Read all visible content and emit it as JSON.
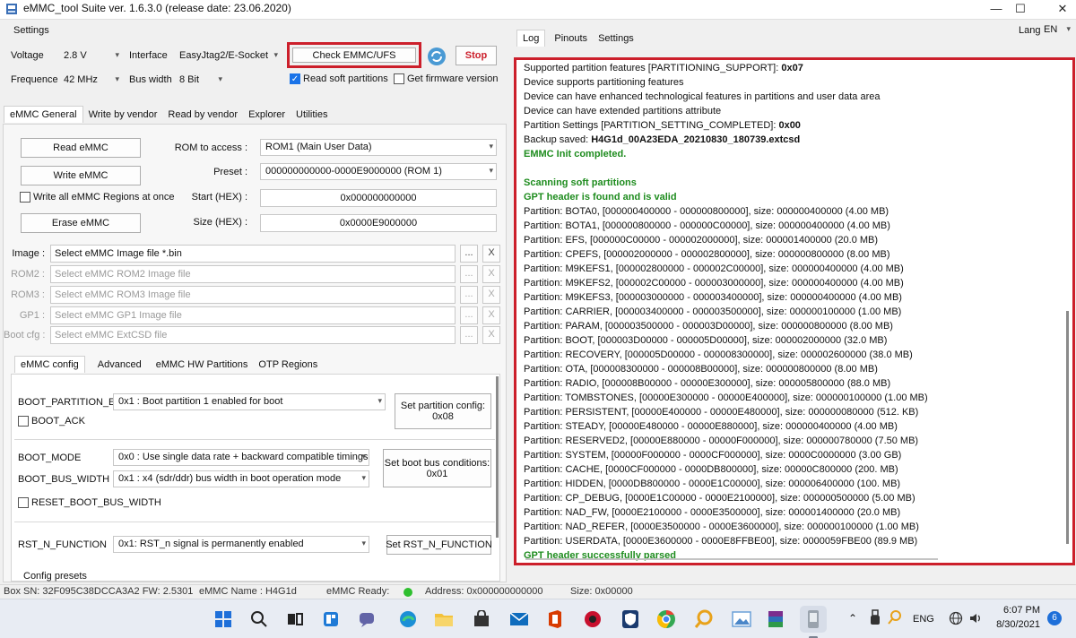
{
  "window": {
    "title": "eMMC_tool Suite  ver. 1.6.3.0 (release date: 23.06.2020)",
    "minimize": "—",
    "maximize": "☐",
    "close": "✕"
  },
  "settings": {
    "group_label": "Settings",
    "voltage_label": "Voltage",
    "voltage_value": "2.8 V",
    "interface_label": "Interface",
    "interface_value": "EasyJtag2/E-Socket",
    "frequency_label": "Frequence",
    "frequency_value": "42 MHz",
    "buswidth_label": "Bus width",
    "buswidth_value": "8 Bit",
    "check_button": "Check EMMC/UFS",
    "stop_button": "Stop",
    "read_soft_partitions": "Read soft partitions",
    "get_firmware_version": "Get firmware version"
  },
  "main_tabs": [
    "eMMC General",
    "Write by vendor",
    "Read by vendor",
    "Explorer",
    "Utilities"
  ],
  "general": {
    "read_button": "Read eMMC",
    "write_button": "Write eMMC",
    "write_all_label": "Write all eMMC Regions at once",
    "erase_button": "Erase eMMC",
    "rom_label": "ROM to access :",
    "rom_value": "ROM1 (Main User Data)",
    "preset_label": "Preset :",
    "preset_value": "000000000000-0000E9000000 (ROM 1)",
    "start_label": "Start (HEX) :",
    "start_value": "0x000000000000",
    "size_label": "Size (HEX) :",
    "size_value": "0x0000E9000000"
  },
  "files": [
    {
      "label": "Image :",
      "placeholder": "Select eMMC Image file *.bin",
      "enabled": true
    },
    {
      "label": "ROM2 :",
      "placeholder": "Select eMMC ROM2 Image file",
      "enabled": false
    },
    {
      "label": "ROM3 :",
      "placeholder": "Select eMMC ROM3 Image file",
      "enabled": false
    },
    {
      "label": "GP1 :",
      "placeholder": "Select eMMC GP1 Image file",
      "enabled": false
    },
    {
      "label": "Boot cfg :",
      "placeholder": "Select eMMC ExtCSD file",
      "enabled": false
    }
  ],
  "file_browse": "...",
  "file_clear": "X",
  "config_tabs": [
    "eMMC config",
    "Advanced",
    "eMMC HW Partitions",
    "OTP Regions"
  ],
  "config": {
    "boot_partition_label": "BOOT_PARTITION_EN",
    "boot_partition_value": "0x1 : Boot partition 1 enabled for boot",
    "boot_ack_label": "BOOT_ACK",
    "set_partition_button_l1": "Set partition config:",
    "set_partition_button_l2": "0x08",
    "boot_mode_label": "BOOT_MODE",
    "boot_mode_value": "0x0 : Use single data rate + backward compatible timings ir",
    "boot_bus_width_label": "BOOT_BUS_WIDTH",
    "boot_bus_width_value": "0x1 : x4 (sdr/ddr) bus width in boot operation mode",
    "set_bus_button_l1": "Set boot bus conditions:",
    "set_bus_button_l2": "0x01",
    "reset_boot_bus_label": "RESET_BOOT_BUS_WIDTH",
    "rst_n_label": "RST_N_FUNCTION",
    "rst_n_value": "0x1: RST_n signal is permanently enabled",
    "set_rst_button": "Set RST_N_FUNCTION",
    "config_presets": "Config presets"
  },
  "right_tabs": [
    "Log",
    "Pinouts",
    "Settings"
  ],
  "lang_label": "Lang",
  "lang_value": "EN",
  "log": [
    {
      "text": "Supported partition features [PARTITIONING_SUPPORT]: ",
      "bold": "0x07",
      "green": false
    },
    {
      "text": "Device supports partitioning features",
      "green": false
    },
    {
      "text": "Device can have enhanced technological features in partitions and user data area",
      "green": false
    },
    {
      "text": "Device can have extended partitions attribute",
      "green": false
    },
    {
      "text": "Partition Settings [PARTITION_SETTING_COMPLETED]: ",
      "bold": "0x00",
      "green": false
    },
    {
      "text": "Backup saved: ",
      "bold": "H4G1d_00A23EDA_20210830_180739.extcsd",
      "green": false
    },
    {
      "text": "EMMC Init completed.",
      "green": true
    },
    {
      "text": "",
      "green": false
    },
    {
      "text": "Scanning soft partitions",
      "green": true
    },
    {
      "text": "GPT header is found and is valid",
      "green": true
    },
    {
      "text": "Partition: BOTA0, [000000400000 - 000000800000], size: 000000400000 (4.00 MB)",
      "green": false
    },
    {
      "text": "Partition: BOTA1, [000000800000 - 000000C00000], size: 000000400000 (4.00 MB)",
      "green": false
    },
    {
      "text": "Partition: EFS, [000000C00000 - 000002000000], size: 000001400000 (20.0 MB)",
      "green": false
    },
    {
      "text": "Partition: CPEFS, [000002000000 - 000002800000], size: 000000800000 (8.00 MB)",
      "green": false
    },
    {
      "text": "Partition: M9KEFS1, [000002800000 - 000002C00000], size: 000000400000 (4.00 MB)",
      "green": false
    },
    {
      "text": "Partition: M9KEFS2, [000002C00000 - 000003000000], size: 000000400000 (4.00 MB)",
      "green": false
    },
    {
      "text": "Partition: M9KEFS3, [000003000000 - 000003400000], size: 000000400000 (4.00 MB)",
      "green": false
    },
    {
      "text": "Partition: CARRIER, [000003400000 - 000003500000], size: 000000100000 (1.00 MB)",
      "green": false
    },
    {
      "text": "Partition: PARAM, [000003500000 - 000003D00000], size: 000000800000 (8.00 MB)",
      "green": false
    },
    {
      "text": "Partition: BOOT, [000003D00000 - 000005D00000], size: 000002000000 (32.0 MB)",
      "green": false
    },
    {
      "text": "Partition: RECOVERY, [000005D00000 - 000008300000], size: 000002600000 (38.0 MB)",
      "green": false
    },
    {
      "text": "Partition: OTA, [000008300000 - 000008B00000], size: 000000800000 (8.00 MB)",
      "green": false
    },
    {
      "text": "Partition: RADIO, [000008B00000 - 00000E300000], size: 000005800000 (88.0 MB)",
      "green": false
    },
    {
      "text": "Partition: TOMBSTONES, [00000E300000 - 00000E400000], size: 000000100000 (1.00 MB)",
      "green": false
    },
    {
      "text": "Partition: PERSISTENT, [00000E400000 - 00000E480000], size: 000000080000 (512. KB)",
      "green": false
    },
    {
      "text": "Partition: STEADY, [00000E480000 - 00000E880000], size: 000000400000 (4.00 MB)",
      "green": false
    },
    {
      "text": "Partition: RESERVED2, [00000E880000 - 00000F000000], size: 000000780000 (7.50 MB)",
      "green": false
    },
    {
      "text": "Partition: SYSTEM, [00000F000000 - 0000CF000000], size: 0000C0000000 (3.00 GB)",
      "green": false
    },
    {
      "text": "Partition: CACHE, [0000CF000000 - 0000DB800000], size: 00000C800000 (200. MB)",
      "green": false
    },
    {
      "text": "Partition: HIDDEN, [0000DB800000 - 0000E1C00000], size: 000006400000 (100. MB)",
      "green": false
    },
    {
      "text": "Partition: CP_DEBUG, [0000E1C00000 - 0000E2100000], size: 000000500000 (5.00 MB)",
      "green": false
    },
    {
      "text": "Partition: NAD_FW, [0000E2100000 - 0000E3500000], size: 000001400000 (20.0 MB)",
      "green": false
    },
    {
      "text": "Partition: NAD_REFER, [0000E3500000 - 0000E3600000], size: 000000100000 (1.00 MB)",
      "green": false
    },
    {
      "text": "Partition: USERDATA, [0000E3600000 - 0000E8FFBE00], size: 0000059FBE00 (89.9 MB)",
      "green": false
    },
    {
      "text": "GPT header successfully parsed",
      "green": true
    }
  ],
  "status": {
    "box_sn": "Box SN: 32F095C38DCCA3A2  FW: 2.5301",
    "emmc_name": "eMMC Name : H4G1d",
    "ready": "eMMC Ready:",
    "address": "Address: 0x000000000000",
    "size": "Size: 0x00000"
  },
  "taskbar": {
    "lang": "ENG",
    "time": "6:07 PM",
    "date": "8/30/2021",
    "notifications": "6"
  },
  "colors": {
    "highlight_red": "#cc1f2b",
    "log_green": "#1e8c1e",
    "stop_red": "#cc1f2b"
  }
}
